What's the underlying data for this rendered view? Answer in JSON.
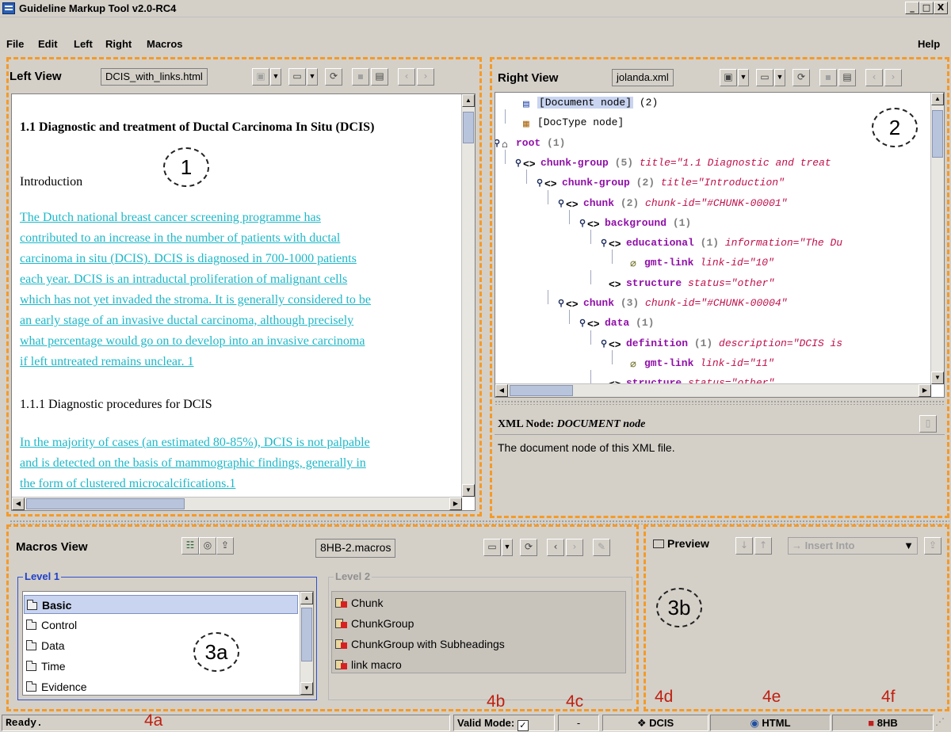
{
  "window": {
    "title": "Guideline Markup Tool v2.0-RC4",
    "buttons": {
      "minimize": "_",
      "maximize": "□",
      "close": "X"
    }
  },
  "menu": {
    "items": [
      {
        "label": "File"
      },
      {
        "label": "Edit"
      },
      {
        "label": "Left"
      },
      {
        "label": "Right"
      },
      {
        "label": "Macros"
      }
    ],
    "help": "Help"
  },
  "left_view": {
    "title": "Left View",
    "file": "DCIS_with_links.html",
    "heading": "1.1 Diagnostic and treatment of Ductal Carcinoma In Situ (DCIS)",
    "intro": "Introduction",
    "para1_lines": [
      "The Dutch national breast cancer screening programme has",
      "contributed to an increase in the number of patients with ductal",
      "carcinoma in situ (DCIS). DCIS is diagnosed in 700-1000 patients",
      "each year. DCIS is an intraductal proliferation of malignant cells",
      "which has not yet invaded the stroma. It is generally considered to be",
      "an early stage of an invasive ductal carcinoma, although precisely",
      "what percentage would go on to develop into an invasive carcinoma",
      "if left untreated remains unclear. 1"
    ],
    "subheading": "1.1.1 Diagnostic procedures for DCIS",
    "para2_lines": [
      "In the majority of cases (an estimated 80-85%), DCIS is not palpable",
      "and is detected on the basis of mammographic findings, generally in",
      "the form of clustered microcalcifications.1"
    ]
  },
  "right_view": {
    "title": "Right View",
    "file": "jolanda.xml",
    "tree": [
      {
        "tag": "[Document node]",
        "count": "(2)",
        "attr": ""
      },
      {
        "tag": "[DocType node]",
        "count": "",
        "attr": ""
      },
      {
        "tag": "root",
        "count": "(1)",
        "attr": ""
      },
      {
        "tag": "chunk-group",
        "count": "(5)",
        "attr": "title=\"1.1 Diagnostic and treat"
      },
      {
        "tag": "chunk-group",
        "count": "(2)",
        "attr": "title=\"Introduction\""
      },
      {
        "tag": "chunk",
        "count": "(2)",
        "attr": "chunk-id=\"#CHUNK-00001\""
      },
      {
        "tag": "background",
        "count": "(1)",
        "attr": ""
      },
      {
        "tag": "educational",
        "count": "(1)",
        "attr": "information=\"The Du"
      },
      {
        "tag": "gmt-link",
        "count": "",
        "attr": "link-id=\"10\""
      },
      {
        "tag": "structure",
        "count": "",
        "attr": "status=\"other\""
      },
      {
        "tag": "chunk",
        "count": "(3)",
        "attr": "chunk-id=\"#CHUNK-00004\""
      },
      {
        "tag": "data",
        "count": "(1)",
        "attr": ""
      },
      {
        "tag": "definition",
        "count": "(1)",
        "attr": "description=\"DCIS is"
      },
      {
        "tag": "gmt-link",
        "count": "",
        "attr": "link-id=\"11\""
      },
      {
        "tag": "structure",
        "count": "",
        "attr": "status=\"other\""
      }
    ],
    "node_panel": {
      "label": "XML Node:",
      "node_type": "DOCUMENT",
      "node_word": "node",
      "description": "The document node of this XML file."
    }
  },
  "macros_view": {
    "title": "Macros View",
    "file": "8HB-2.macros",
    "level1": {
      "label": "Level 1",
      "items": [
        "Basic",
        "Control",
        "Data",
        "Time",
        "Evidence"
      ]
    },
    "level2": {
      "label": "Level 2",
      "items": [
        "Chunk",
        "ChunkGroup",
        "ChunkGroup with Subheadings",
        "link macro"
      ]
    },
    "preview": {
      "label": "Preview",
      "insert": "Insert Into"
    }
  },
  "annotations": {
    "a1": "1",
    "a2": "2",
    "a3a": "3a",
    "a3b": "3b",
    "a4a": "4a",
    "a4b": "4b",
    "a4c": "4c",
    "a4d": "4d",
    "a4e": "4e",
    "a4f": "4f"
  },
  "status": {
    "ready": "Ready.",
    "valid_mode": "Valid Mode:",
    "dash": "-",
    "dcis": "DCIS",
    "html": "HTML",
    "hb": "8HB"
  },
  "colors": {
    "accent_orange": "#f59a28",
    "link_cyan": "#1eb8c8",
    "tag_purple": "#9010a8",
    "attr_red": "#c0104a"
  }
}
